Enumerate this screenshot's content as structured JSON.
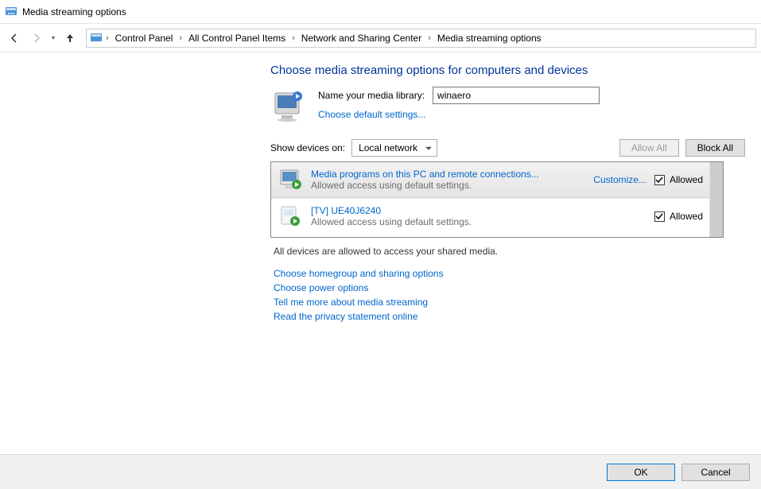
{
  "window_title": "Media streaming options",
  "breadcrumbs": {
    "items": [
      "Control Panel",
      "All Control Panel Items",
      "Network and Sharing Center",
      "Media streaming options"
    ]
  },
  "heading": "Choose media streaming options for computers and devices",
  "library": {
    "name_label": "Name your media library:",
    "name_value": "winaero",
    "defaults_link": "Choose default settings..."
  },
  "devices_bar": {
    "label": "Show devices on:",
    "select_value": "Local network",
    "allow_all": "Allow All",
    "block_all": "Block All",
    "allow_all_disabled": true
  },
  "devices": [
    {
      "title": "Media programs on this PC and remote connections...",
      "sub": "Allowed access using default settings.",
      "customize_label": "Customize...",
      "allowed_label": "Allowed",
      "allowed": true,
      "show_customize": true,
      "selected": true
    },
    {
      "title": "[TV] UE40J6240",
      "sub": "Allowed access using default settings.",
      "allowed_label": "Allowed",
      "allowed": true,
      "show_customize": false,
      "selected": false
    }
  ],
  "status": "All devices are allowed to access your shared media.",
  "links": {
    "homegroup": "Choose homegroup and sharing options",
    "power": "Choose power options",
    "tellme": "Tell me more about media streaming",
    "privacy": "Read the privacy statement online"
  },
  "footer": {
    "ok": "OK",
    "cancel": "Cancel"
  }
}
